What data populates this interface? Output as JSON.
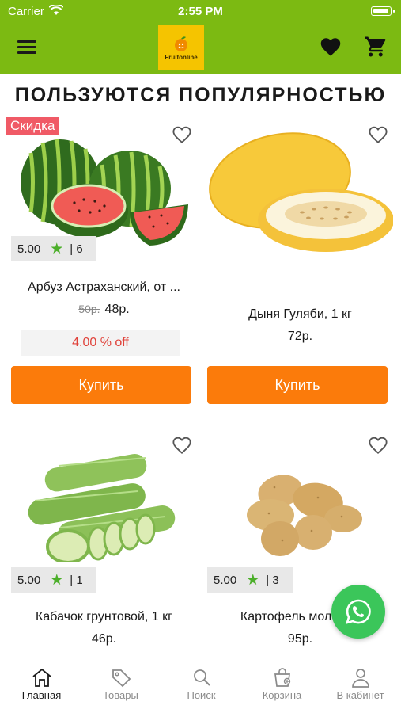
{
  "status": {
    "carrier": "Carrier",
    "time": "2:55 PM"
  },
  "header": {
    "logo_text": "Fruitonline",
    "accent": "#7cba12"
  },
  "section_title": "ПОЛЬЗУЮТСЯ ПОПУЛЯРНОСТЬЮ",
  "products": [
    {
      "name": "Арбуз Астраханский, от ...",
      "badge": "Скидка",
      "rating": "5.00",
      "reviews": "| 6",
      "old_price": "50р.",
      "price": "48р.",
      "discount": "4.00 % off",
      "buy_label": "Купить"
    },
    {
      "name": "Дыня Гуляби, 1 кг",
      "rating": "",
      "reviews": "",
      "price": "72р.",
      "buy_label": "Купить"
    },
    {
      "name": "Кабачок грунтовой, 1 кг",
      "rating": "5.00",
      "reviews": "| 1",
      "price": "46р."
    },
    {
      "name": "Картофель молодой",
      "rating": "5.00",
      "reviews": "| 3",
      "price": "95р."
    }
  ],
  "tabs": [
    {
      "label": "Главная",
      "icon": "home-icon",
      "active": true
    },
    {
      "label": "Товары",
      "icon": "tag-icon"
    },
    {
      "label": "Поиск",
      "icon": "search-icon"
    },
    {
      "label": "Корзина",
      "icon": "basket-icon"
    },
    {
      "label": "В кабинет",
      "icon": "user-icon"
    }
  ],
  "colors": {
    "buy_button": "#fb7b0b",
    "discount_text": "#e0423a",
    "badge": "#f05a66",
    "whatsapp": "#3bc65a"
  }
}
